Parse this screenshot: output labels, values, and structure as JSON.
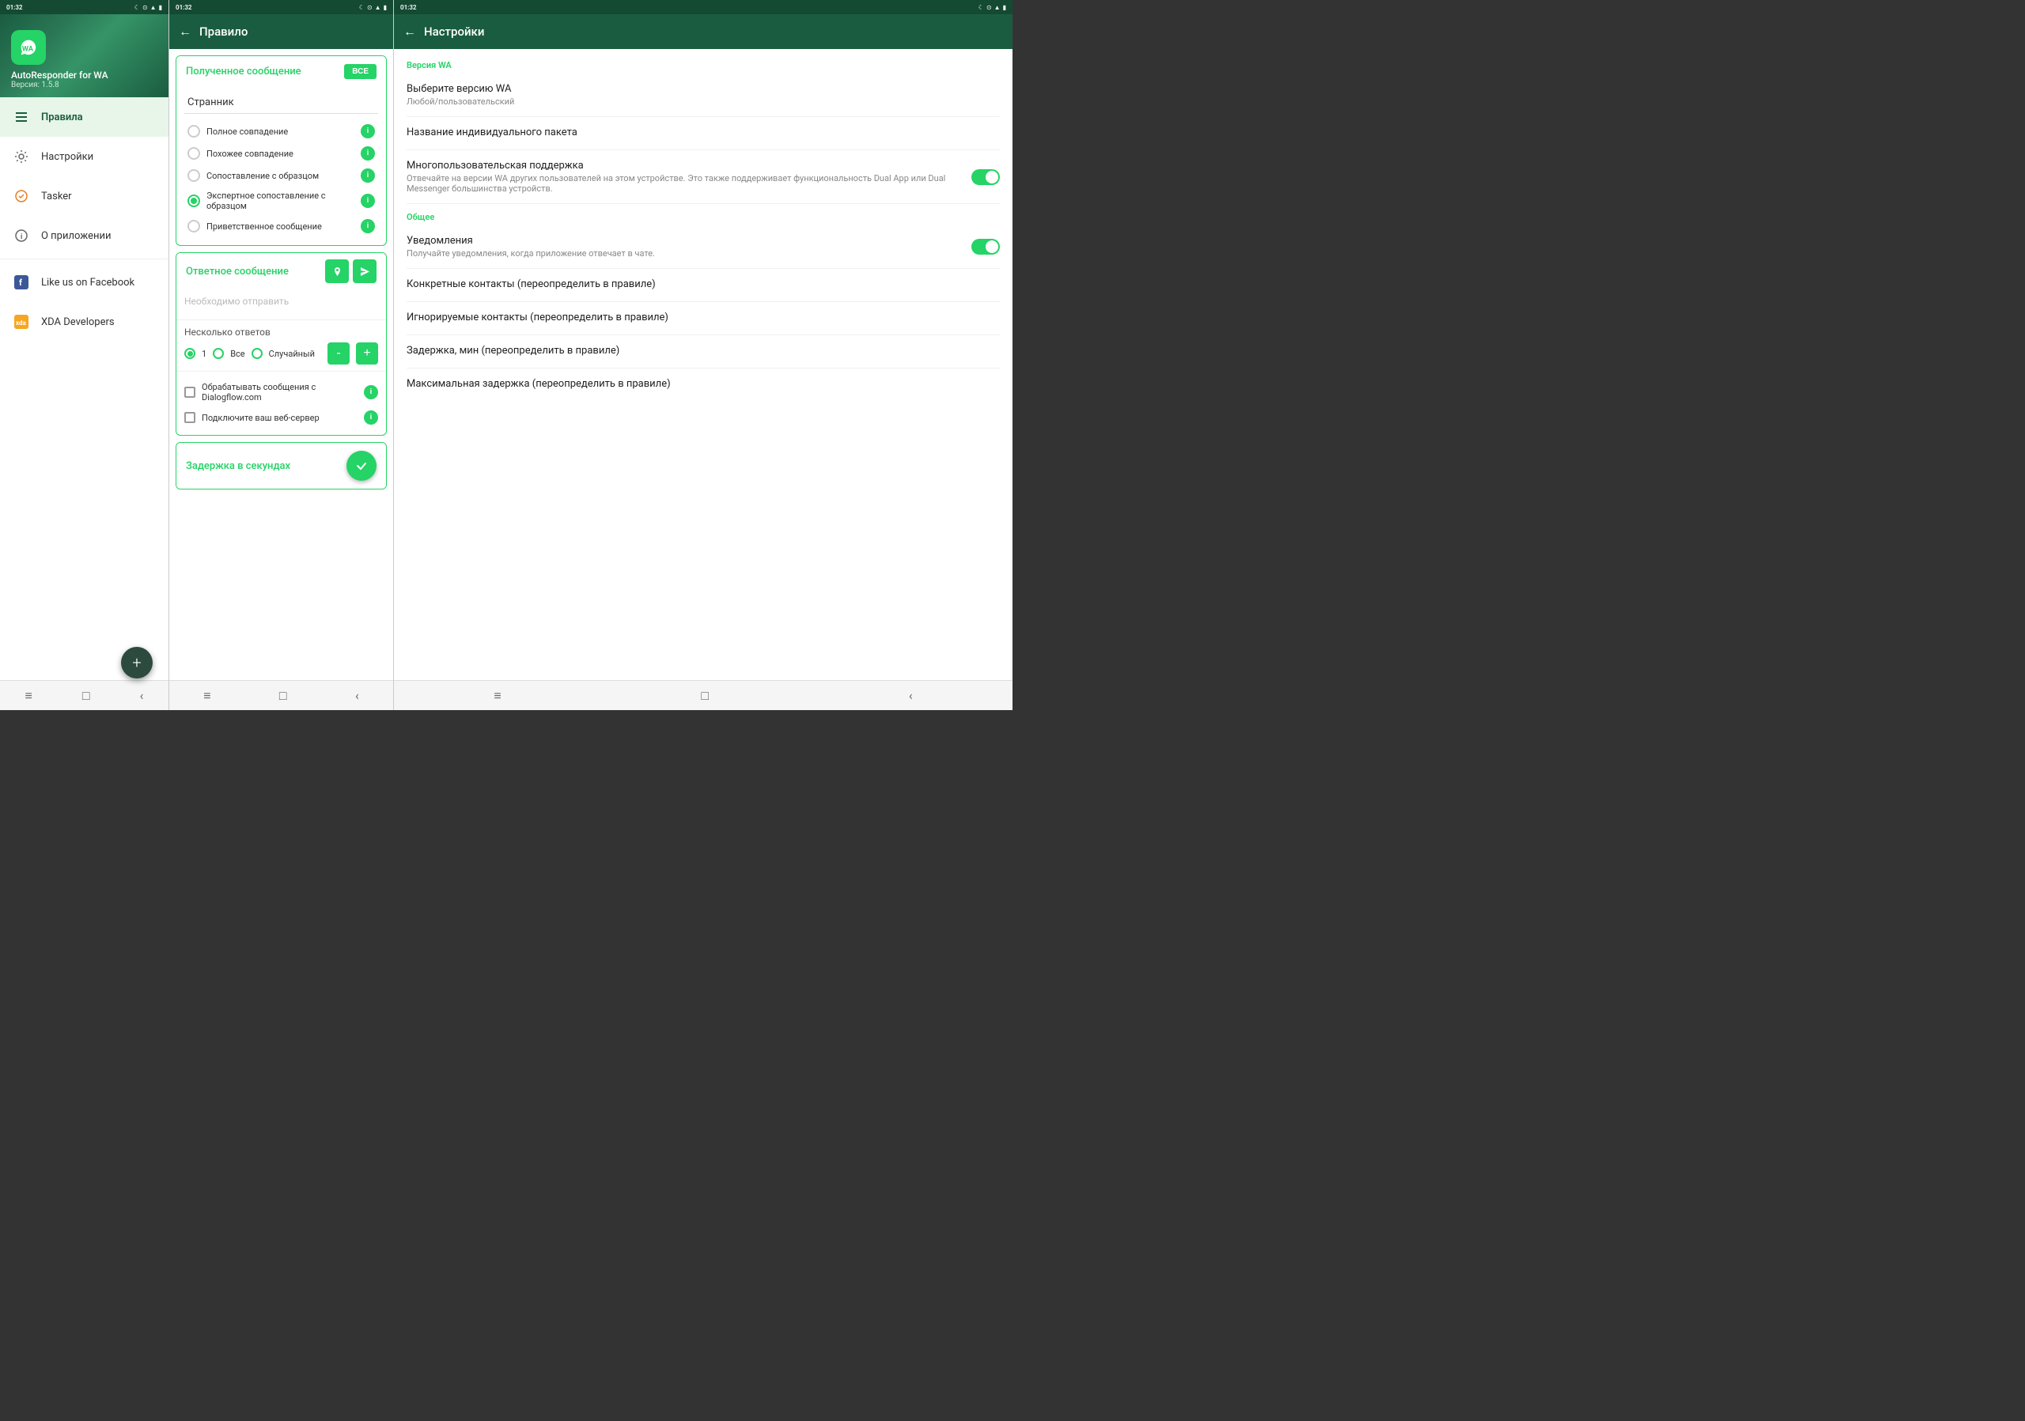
{
  "app": {
    "name": "AutoResponder for WA",
    "version": "Версия: 1.5.8",
    "time": "01:32"
  },
  "drawer": {
    "menu_items": [
      {
        "id": "rules",
        "label": "Правила",
        "icon": "list",
        "active": true
      },
      {
        "id": "settings",
        "label": "Настройки",
        "icon": "gear",
        "active": false
      },
      {
        "id": "tasker",
        "label": "Tasker",
        "icon": "tasker",
        "active": false
      },
      {
        "id": "about",
        "label": "О приложении",
        "icon": "info",
        "active": false
      },
      {
        "id": "facebook",
        "label": "Like us on Facebook",
        "icon": "facebook",
        "active": false
      },
      {
        "id": "xda",
        "label": "XDA Developers",
        "icon": "xda",
        "active": false
      }
    ],
    "fab_label": "+"
  },
  "rule_panel": {
    "title": "Правило",
    "back_label": "←",
    "received_message": {
      "section_title": "Полученное сообщение",
      "btn_all": "ВСЕ",
      "input_value": "Странник",
      "match_options": [
        {
          "id": "full",
          "label": "Полное совпадение",
          "selected": false
        },
        {
          "id": "similar",
          "label": "Похожее совпадение",
          "selected": false
        },
        {
          "id": "pattern",
          "label": "Сопоставление с образцом",
          "selected": false
        },
        {
          "id": "expert",
          "label": "Экспертное сопоставление с образцом",
          "selected": true
        },
        {
          "id": "welcome",
          "label": "Приветственное сообщение",
          "selected": false
        }
      ]
    },
    "response_message": {
      "section_title": "Ответное сообщение",
      "placeholder": "Необходимо отправить",
      "multiple_title": "Несколько ответов",
      "radio_options": [
        {
          "id": "one",
          "label": "1",
          "selected": true
        },
        {
          "id": "all",
          "label": "Все",
          "selected": false
        },
        {
          "id": "random",
          "label": "Случайный",
          "selected": false
        }
      ],
      "minus_label": "-",
      "plus_label": "+",
      "checkboxes": [
        {
          "id": "dialogflow",
          "label": "Обрабатывать сообщения с Dialogflow.com",
          "checked": false
        },
        {
          "id": "webserver",
          "label": "Подключите ваш веб-сервер",
          "checked": false
        }
      ]
    },
    "delay_section": {
      "title": "Задержка в секундах"
    }
  },
  "settings_panel": {
    "title": "Настройки",
    "back_label": "←",
    "sections": [
      {
        "title": "Версия WA",
        "items": [
          {
            "id": "wa_version",
            "title": "Выберите версию WA",
            "subtitle": "Любой/пользовательский",
            "has_toggle": false,
            "toggle_on": false
          },
          {
            "id": "package_name",
            "title": "Название индивидуального пакета",
            "subtitle": "",
            "has_toggle": false
          },
          {
            "id": "multiuser",
            "title": "Многопользовательская поддержка",
            "subtitle": "Отвечайте на версии WA других пользователей на этом устройстве. Это также поддерживает функциональность Dual App или Dual Messenger большинства устройств.",
            "has_toggle": true,
            "toggle_on": true
          }
        ]
      },
      {
        "title": "Общее",
        "items": [
          {
            "id": "notifications",
            "title": "Уведомления",
            "subtitle": "Получайте уведомления, когда приложение отвечает в чате.",
            "has_toggle": true,
            "toggle_on": true
          },
          {
            "id": "specific_contacts",
            "title": "Конкретные контакты (переопределить в правиле)",
            "subtitle": "",
            "has_toggle": false
          },
          {
            "id": "ignored_contacts",
            "title": "Игнорируемые контакты (переопределить в правиле)",
            "subtitle": "",
            "has_toggle": false
          },
          {
            "id": "delay_min",
            "title": "Задержка, мин (переопределить в правиле)",
            "subtitle": "",
            "has_toggle": false
          },
          {
            "id": "max_delay",
            "title": "Максимальная задержка (переопределить в правиле)",
            "subtitle": "",
            "has_toggle": false
          }
        ]
      }
    ]
  },
  "bottom_nav": {
    "menu_icon": "≡",
    "home_icon": "□",
    "back_icon": "‹"
  }
}
